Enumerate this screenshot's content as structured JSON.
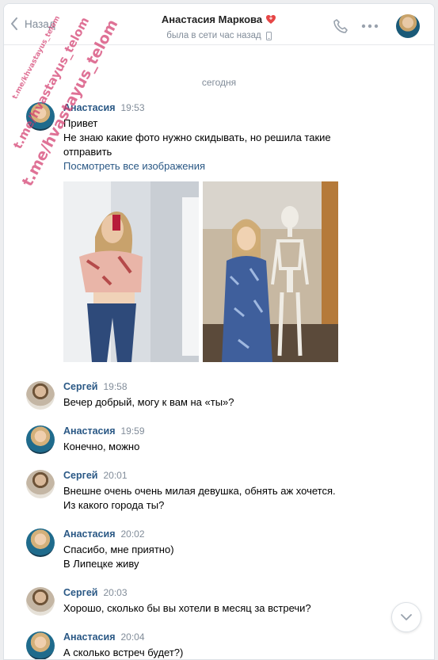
{
  "header": {
    "back_label": "Назад",
    "contact_name": "Анастасия Маркова",
    "status": "была в сети час назад"
  },
  "feed": {
    "date_separator": "сегодня",
    "messages": [
      {
        "author": "Анастасия",
        "time": "19:53",
        "lines": [
          "Привет",
          "Не знаю какие фото нужно скидывать, но решила такие отправить"
        ],
        "link": "Посмотреть все изображения",
        "photos": [
          "photo-mirror-selfie",
          "photo-with-skeleton"
        ]
      },
      {
        "author": "Сергей",
        "time": "19:58",
        "lines": [
          "Вечер добрый, могу к вам на «ты»?"
        ]
      },
      {
        "author": "Анастасия",
        "time": "19:59",
        "lines": [
          "Конечно, можно"
        ]
      },
      {
        "author": "Сергей",
        "time": "20:01",
        "lines": [
          "Внешне очень очень милая девушка, обнять аж хочется.",
          "Из какого города ты?"
        ]
      },
      {
        "author": "Анастасия",
        "time": "20:02",
        "lines": [
          "Спасибо, мне приятно)",
          "В Липецке живу"
        ]
      },
      {
        "author": "Сергей",
        "time": "20:03",
        "lines": [
          "Хорошо, сколько бы вы хотели в месяц за встречи?"
        ]
      },
      {
        "author": "Анастасия",
        "time": "20:04",
        "lines": [
          "А сколько встреч будет?)"
        ]
      }
    ]
  },
  "watermark": {
    "text_small": "t.me/khvastayus_telom",
    "text_medium": "t.me/hvastayus_telom",
    "text_large": "t.me/hvastayus_telom"
  },
  "colors": {
    "name": "#2a5885",
    "muted": "#818c99",
    "watermark": "#d23c6e",
    "heart": "#e64646"
  }
}
